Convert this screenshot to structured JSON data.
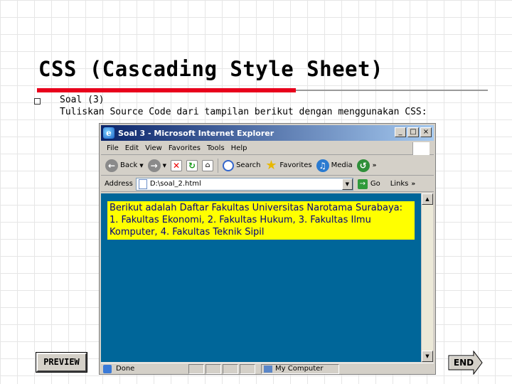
{
  "slide": {
    "title": "CSS (Cascading Style Sheet)",
    "bullet_heading": "Soal (3)",
    "bullet_text": "Tuliskan Source Code dari tampilan berikut dengan menggunakan CSS:",
    "accent_color": "#e8001c"
  },
  "browser": {
    "window_title": "Soal 3 - Microsoft Internet Explorer",
    "window_buttons": [
      "_",
      "□",
      "×"
    ],
    "menu": [
      "File",
      "Edit",
      "View",
      "Favorites",
      "Tools",
      "Help"
    ],
    "toolbar": {
      "back": "Back",
      "search": "Search",
      "favorites": "Favorites",
      "media": "Media"
    },
    "address": {
      "label": "Address",
      "value": "D:\\soal_2.html",
      "go": "Go",
      "links": "Links"
    },
    "page": {
      "background": "#006699",
      "highlight": "#ffff00",
      "text_color": "#000080",
      "paragraph": "Berikut adalah Daftar Fakultas Universitas Narotama Surabaya: 1. Fakultas Ekonomi, 2. Fakultas Hukum, 3. Fakultas Ilmu Komputer, 4. Fakultas Teknik Sipil"
    },
    "status": {
      "text": "Done",
      "zone": "My Computer"
    }
  },
  "nav": {
    "preview": "PREVIEW",
    "end": "END"
  }
}
